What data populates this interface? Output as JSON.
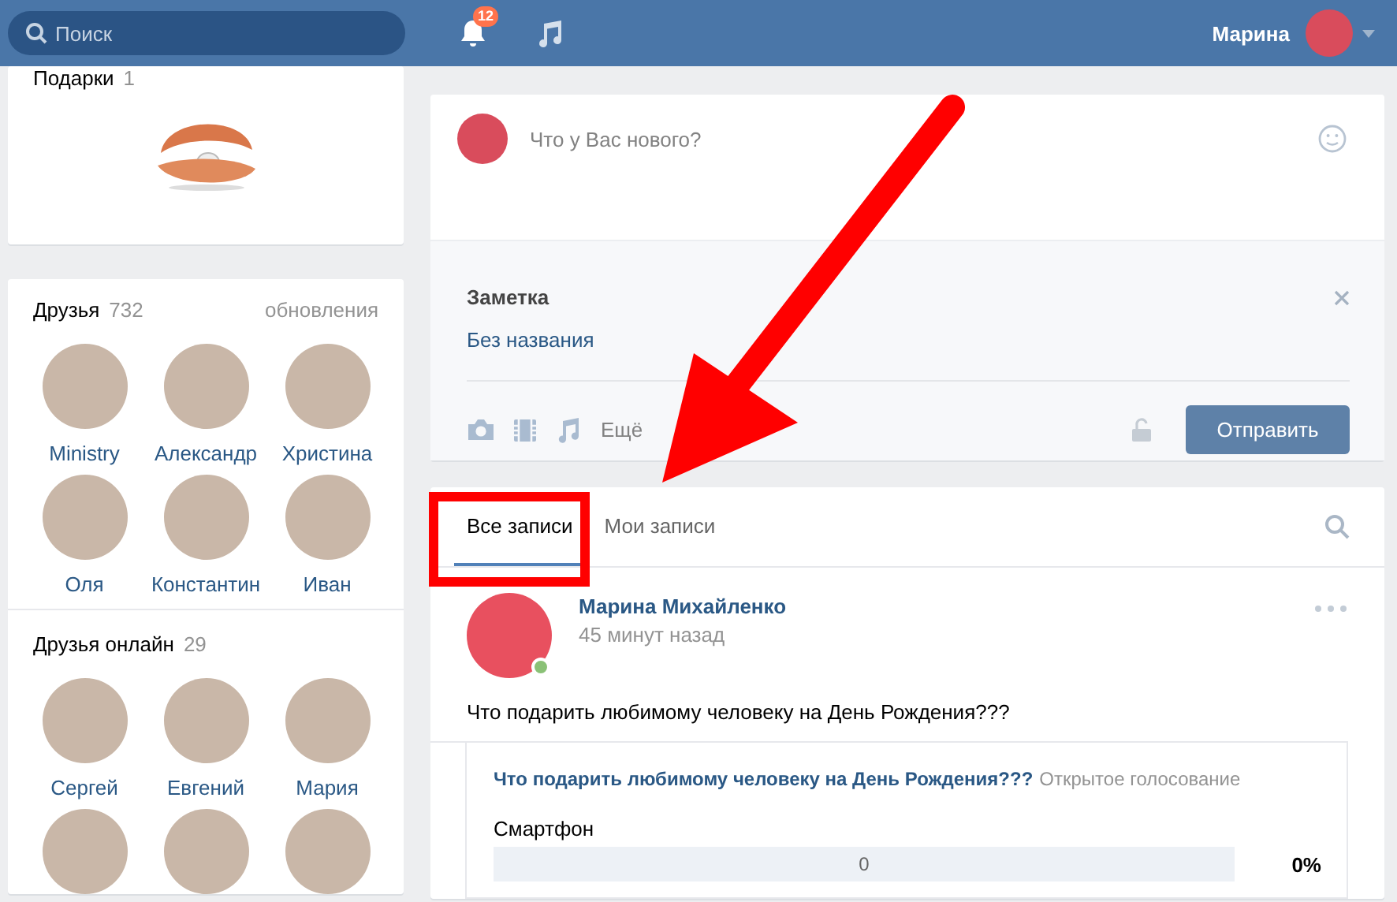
{
  "header": {
    "search": {
      "placeholder": "Поиск"
    },
    "notifications_badge": "12",
    "user_name": "Марина"
  },
  "gifts": {
    "title": "Подарки",
    "count": "1"
  },
  "friends": {
    "title": "Друзья",
    "count": "732",
    "link": "обновления",
    "items": [
      {
        "name": "Ministry"
      },
      {
        "name": "Александр"
      },
      {
        "name": "Христина"
      },
      {
        "name": "Оля"
      },
      {
        "name": "Константин"
      },
      {
        "name": "Иван"
      }
    ]
  },
  "friends_online": {
    "title": "Друзья онлайн",
    "count": "29",
    "items": [
      {
        "name": "Сергей"
      },
      {
        "name": "Евгений"
      },
      {
        "name": "Мария"
      },
      {
        "kind": "cut"
      },
      {
        "kind": "cut"
      },
      {
        "kind": "cut"
      }
    ]
  },
  "composer": {
    "placeholder": "Что у Вас нового?",
    "note_label": "Заметка",
    "note_title": "Без названия",
    "more": "Ещё",
    "submit": "Отправить"
  },
  "wall": {
    "tabs": [
      {
        "label": "Все записи",
        "selected": true,
        "highlighted": true
      },
      {
        "label": "Мои записи",
        "selected": false,
        "highlighted": false
      }
    ],
    "post": {
      "author": "Марина Михайленко",
      "online": true,
      "time": "45 минут назад",
      "text": "Что подарить любимому человеку на День Рождения???",
      "poll": {
        "question": "Что подарить любимому человеку на День Рождения???",
        "type": "Открытое голосование",
        "options": [
          {
            "label": "Смартфон",
            "count": "0",
            "percent": "0%",
            "level": 0
          }
        ]
      }
    }
  },
  "annotation_arrow": true
}
